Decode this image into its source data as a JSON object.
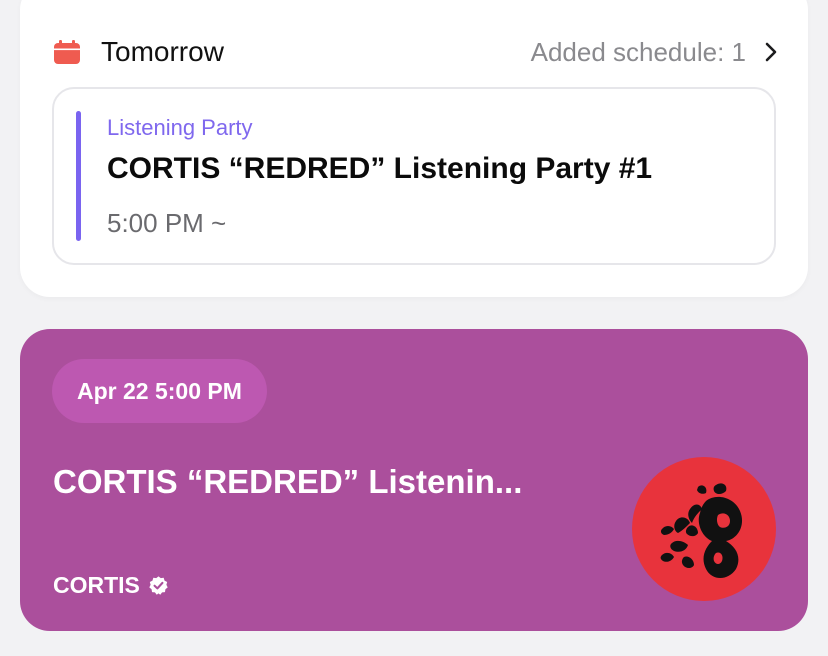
{
  "schedule": {
    "day_label": "Tomorrow",
    "added_text": "Added schedule: 1",
    "calendar_icon_color": "#ef5b50",
    "event": {
      "category": "Listening Party",
      "title": "CORTIS “REDRED” Listening Party #1",
      "time": "5:00 PM ~",
      "accent_color": "#7a64f0"
    }
  },
  "promo": {
    "date": "Apr 22 5:00 PM",
    "title": "CORTIS “REDRED” Listenin...",
    "artist": "CORTIS",
    "background_color": "#ab4f9c",
    "avatar_color": "#e8333c",
    "icons": [
      "verified-badge-icon"
    ]
  }
}
